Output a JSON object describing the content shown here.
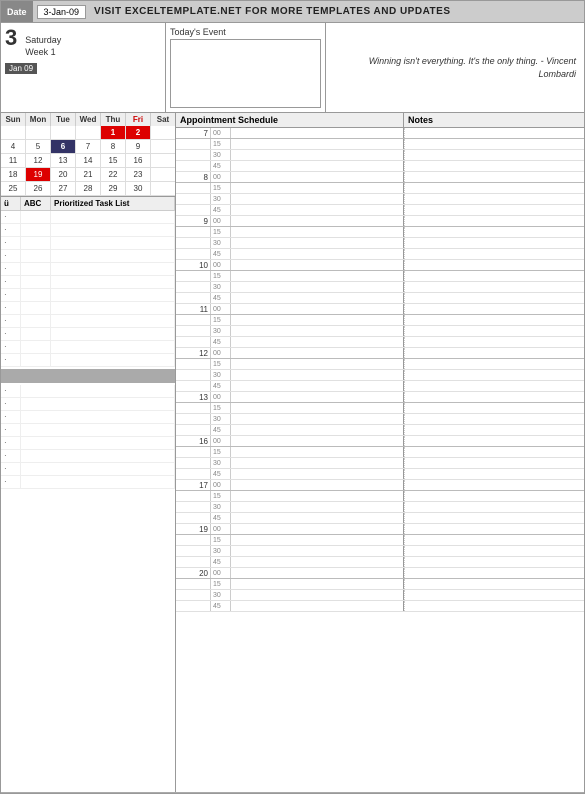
{
  "header": {
    "date_label": "Date",
    "date_value": "3-Jan-09",
    "title": "VISIT EXCELTEMPLATE.NET FOR MORE TEMPLATES AND UPDATES"
  },
  "day_info": {
    "number": "3",
    "day_name": "Saturday",
    "week": "Week 1",
    "month_badge": "Jan 09"
  },
  "today_event": {
    "label": "Today's Event",
    "value": ""
  },
  "quote": {
    "text": "Winning isn't everything. It's the only thing. - Vincent Lombardi"
  },
  "calendar": {
    "headers": [
      "Sun",
      "Mon",
      "Tue",
      "Wed",
      "Thu",
      "Fri",
      "Sat"
    ],
    "rows": [
      [
        "",
        "",
        "",
        "",
        "1",
        "2",
        ""
      ],
      [
        "4",
        "5",
        "6",
        "7",
        "8",
        "9",
        ""
      ],
      [
        "11",
        "12",
        "13",
        "14",
        "15",
        "16",
        ""
      ],
      [
        "18",
        "19",
        "20",
        "21",
        "22",
        "23",
        ""
      ],
      [
        "25",
        "26",
        "27",
        "28",
        "29",
        "30",
        ""
      ]
    ],
    "special": {
      "fri1": {
        "row": 0,
        "col": 4,
        "style": "red-bg"
      },
      "fri2": {
        "row": 0,
        "col": 5,
        "style": "red-bg"
      },
      "mon6": {
        "row": 1,
        "col": 2,
        "style": "blue-bg"
      },
      "mon19": {
        "row": 3,
        "col": 1,
        "style": "red-border"
      }
    }
  },
  "task_headers": {
    "u": "ü",
    "abc": "ABC",
    "task": "Prioritized Task List"
  },
  "schedule": {
    "title": "Appointment Schedule",
    "notes_title": "Notes",
    "time_slots": [
      {
        "hour": "7",
        "minutes": [
          "00",
          "15",
          "30",
          "45"
        ]
      },
      {
        "hour": "8",
        "minutes": [
          "00",
          "15",
          "30",
          "45"
        ]
      },
      {
        "hour": "9",
        "minutes": [
          "00",
          "15",
          "30",
          "45"
        ]
      },
      {
        "hour": "10",
        "minutes": [
          "00",
          "15",
          "30",
          "45"
        ]
      },
      {
        "hour": "11",
        "minutes": [
          "00",
          "15",
          "30",
          "45"
        ]
      },
      {
        "hour": "12",
        "minutes": [
          "00",
          "15",
          "30",
          "45"
        ]
      },
      {
        "hour": "13",
        "minutes": [
          "00",
          "15",
          "30",
          "45"
        ]
      },
      {
        "hour": "16",
        "minutes": [
          "00",
          "15",
          "30",
          "45"
        ]
      },
      {
        "hour": "17",
        "minutes": [
          "00",
          "15",
          "30",
          "45"
        ]
      },
      {
        "hour": "19",
        "minutes": [
          "00",
          "15",
          "30",
          "45"
        ]
      },
      {
        "hour": "20",
        "minutes": [
          "00",
          "15",
          "30",
          "45"
        ]
      }
    ]
  }
}
